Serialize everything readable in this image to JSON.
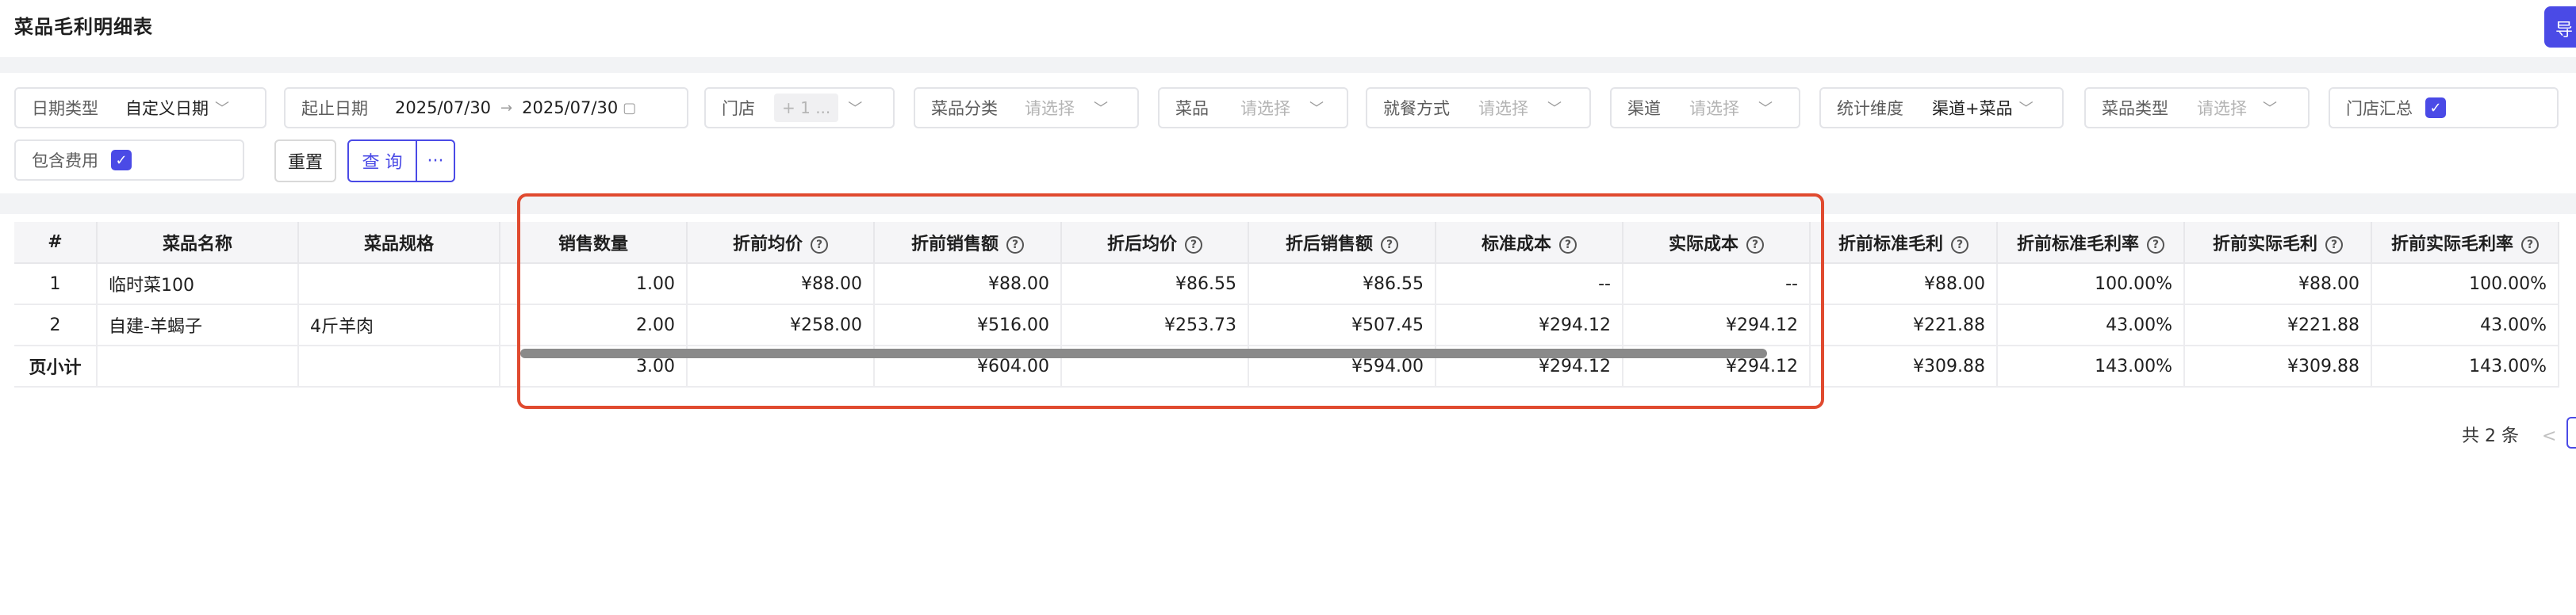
{
  "header": {
    "title": "菜品毛利明细表",
    "export_label": "导"
  },
  "filters": {
    "date_type": {
      "label": "日期类型",
      "value": "自定义日期"
    },
    "date_range": {
      "label": "起止日期",
      "start": "2025/07/30",
      "end": "2025/07/30"
    },
    "store": {
      "label": "门店",
      "tag": "+ 1 ..."
    },
    "dish_category": {
      "label": "菜品分类",
      "placeholder": "请选择"
    },
    "dish": {
      "label": "菜品",
      "placeholder": "请选择"
    },
    "dining_mode": {
      "label": "就餐方式",
      "placeholder": "请选择"
    },
    "channel": {
      "label": "渠道",
      "placeholder": "请选择"
    },
    "dimension": {
      "label": "统计维度",
      "value": "渠道+菜品"
    },
    "dish_type": {
      "label": "菜品类型",
      "placeholder": "请选择"
    },
    "store_summary": {
      "label": "门店汇总",
      "checked": true
    },
    "include_cost": {
      "label": "包含费用",
      "checked": true
    }
  },
  "buttons": {
    "reset": "重置",
    "query": "查 询",
    "more": "···"
  },
  "table": {
    "columns": [
      "#",
      "菜品名称",
      "菜品规格",
      "销售数量",
      "折前均价",
      "折前销售额",
      "折后均价",
      "折后销售额",
      "标准成本",
      "实际成本",
      "折前标准毛利",
      "折前标准毛利率",
      "折前实际毛利",
      "折前实际毛利率"
    ],
    "rows": [
      [
        "1",
        "临时菜100",
        "",
        "1.00",
        "¥88.00",
        "¥88.00",
        "¥86.55",
        "¥86.55",
        "--",
        "--",
        "¥88.00",
        "100.00%",
        "¥88.00",
        "100.00%"
      ],
      [
        "2",
        "自建-羊蝎子",
        "4斤羊肉",
        "2.00",
        "¥258.00",
        "¥516.00",
        "¥253.73",
        "¥507.45",
        "¥294.12",
        "¥294.12",
        "¥221.88",
        "43.00%",
        "¥221.88",
        "43.00%"
      ]
    ],
    "subtotal": [
      "页小计",
      "",
      "",
      "3.00",
      "",
      "¥604.00",
      "",
      "¥594.00",
      "¥294.12",
      "¥294.12",
      "¥309.88",
      "143.00%",
      "¥309.88",
      "143.00%"
    ]
  },
  "pagination": {
    "total": "共 2 条",
    "prev": "<"
  },
  "colors": {
    "accent": "#4a4ae6",
    "highlight": "#e04a2f"
  },
  "icons": {
    "help": "question-circle-icon",
    "calendar": "calendar-icon",
    "arrow": "chevron-down-icon"
  }
}
